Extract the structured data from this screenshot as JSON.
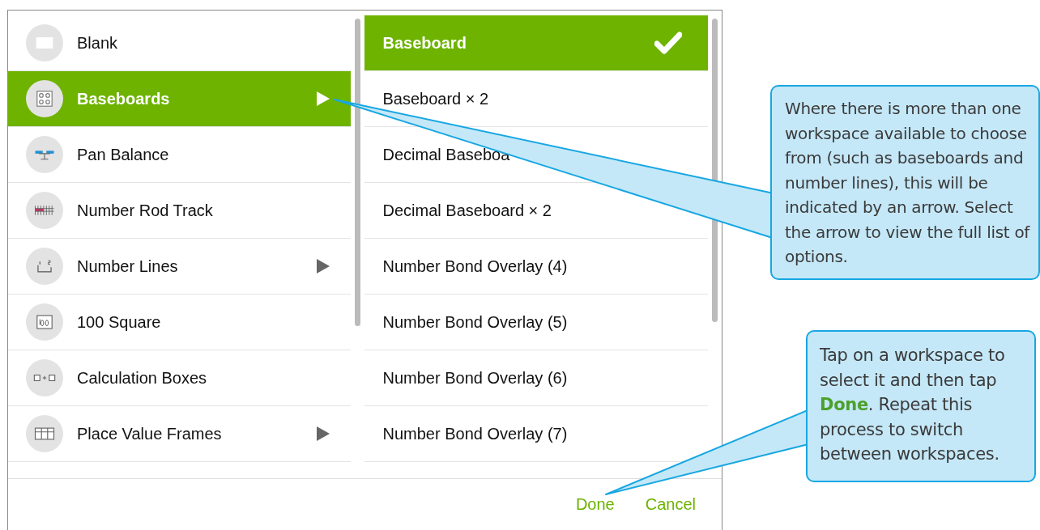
{
  "workspace_list": [
    {
      "label": "Blank",
      "selected": false,
      "has_submenu": false
    },
    {
      "label": "Baseboards",
      "selected": true,
      "has_submenu": true
    },
    {
      "label": "Pan Balance",
      "selected": false,
      "has_submenu": false
    },
    {
      "label": "Number Rod Track",
      "selected": false,
      "has_submenu": false
    },
    {
      "label": "Number Lines",
      "selected": false,
      "has_submenu": true
    },
    {
      "label": "100 Square",
      "selected": false,
      "has_submenu": false
    },
    {
      "label": "Calculation Boxes",
      "selected": false,
      "has_submenu": false
    },
    {
      "label": "Place Value Frames",
      "selected": false,
      "has_submenu": true
    }
  ],
  "submenu_list": [
    {
      "label": "Baseboard",
      "selected": true
    },
    {
      "label": "Baseboard × 2",
      "selected": false
    },
    {
      "label": "Decimal Baseboa",
      "selected": false
    },
    {
      "label": "Decimal Baseboard × 2",
      "selected": false
    },
    {
      "label": "Number Bond Overlay (4)",
      "selected": false
    },
    {
      "label": "Number Bond Overlay (5)",
      "selected": false
    },
    {
      "label": "Number Bond Overlay (6)",
      "selected": false
    },
    {
      "label": "Number Bond Overlay (7)",
      "selected": false
    }
  ],
  "buttons": [
    "Done",
    "Cancel"
  ],
  "callouts": [
    {
      "text": "Where there is more than one workspace available to choose from (such as baseboards and number lines), this will be indicated by an arrow. Select the arrow to view the full list of options."
    },
    {
      "text": "Tap on a workspace to select it and then tap **Done**. Repeat this process to switch between workspaces."
    }
  ]
}
